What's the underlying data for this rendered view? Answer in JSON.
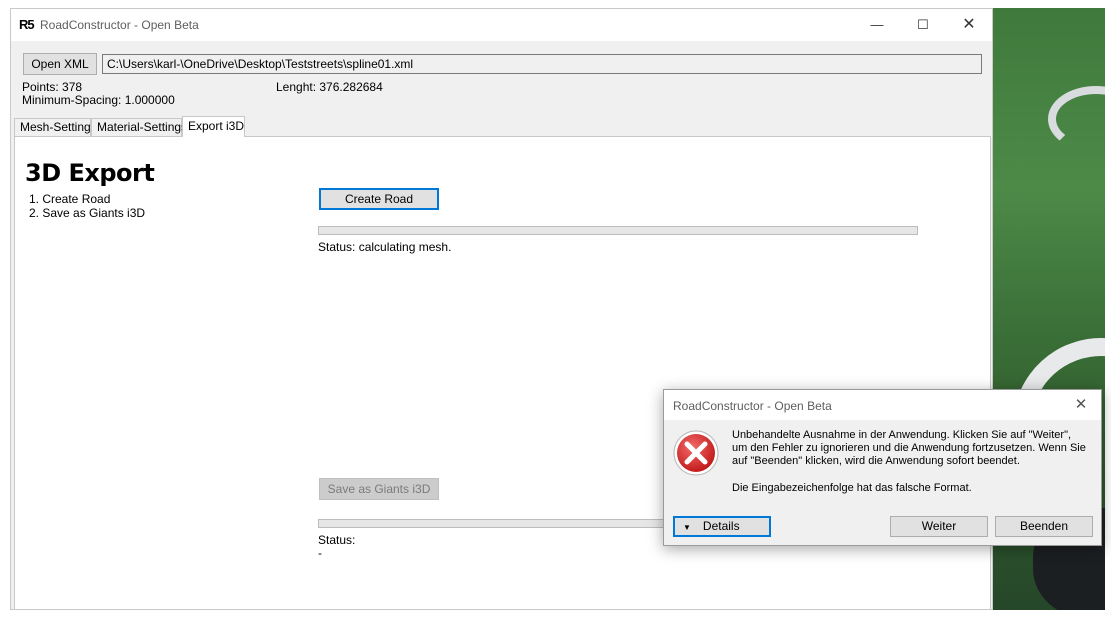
{
  "window": {
    "logo": "R5",
    "title": "RoadConstructor - Open Beta",
    "controls": {
      "minimize": "—",
      "maximize": "☐",
      "close": "✕"
    }
  },
  "toolbar": {
    "open_xml_label": "Open XML",
    "file_path": "C:\\Users\\karl-\\OneDrive\\Desktop\\Teststreets\\spline01.xml"
  },
  "info": {
    "points": "Points: 378",
    "min_spacing": "Minimum-Spacing: 1.000000",
    "length": "Lenght: 376.282684"
  },
  "tabs": [
    {
      "label": "Mesh-Settings",
      "active": false
    },
    {
      "label": "Material-Settings",
      "active": false
    },
    {
      "label": "Export i3D",
      "active": true
    }
  ],
  "export_panel": {
    "heading": "3D Export",
    "steps": [
      "1. Create Road",
      "2. Save as Giants i3D"
    ],
    "create_road_label": "Create Road",
    "status_create": "Status: calculating mesh.",
    "save_label": "Save as Giants i3D",
    "status_save": "Status:",
    "status_save_value": "-"
  },
  "error_dialog": {
    "title": "RoadConstructor - Open Beta",
    "close": "✕",
    "icon": "error-icon",
    "message_lines": [
      "Unbehandelte Ausnahme in der Anwendung. Klicken Sie auf \"Weiter\",",
      "um den Fehler zu ignorieren und die Anwendung fortzusetzen. Wenn Sie",
      "auf \"Beenden\" klicken, wird die Anwendung sofort beendet."
    ],
    "detail_message": "Die Eingabezeichenfolge hat das falsche Format.",
    "details_label": "Details",
    "details_arrow": "▼",
    "continue_label": "Weiter",
    "quit_label": "Beenden"
  },
  "colors": {
    "focus_blue": "#0078d7",
    "error_red": "#d92b2b",
    "window_bg": "#f0f0f0"
  }
}
